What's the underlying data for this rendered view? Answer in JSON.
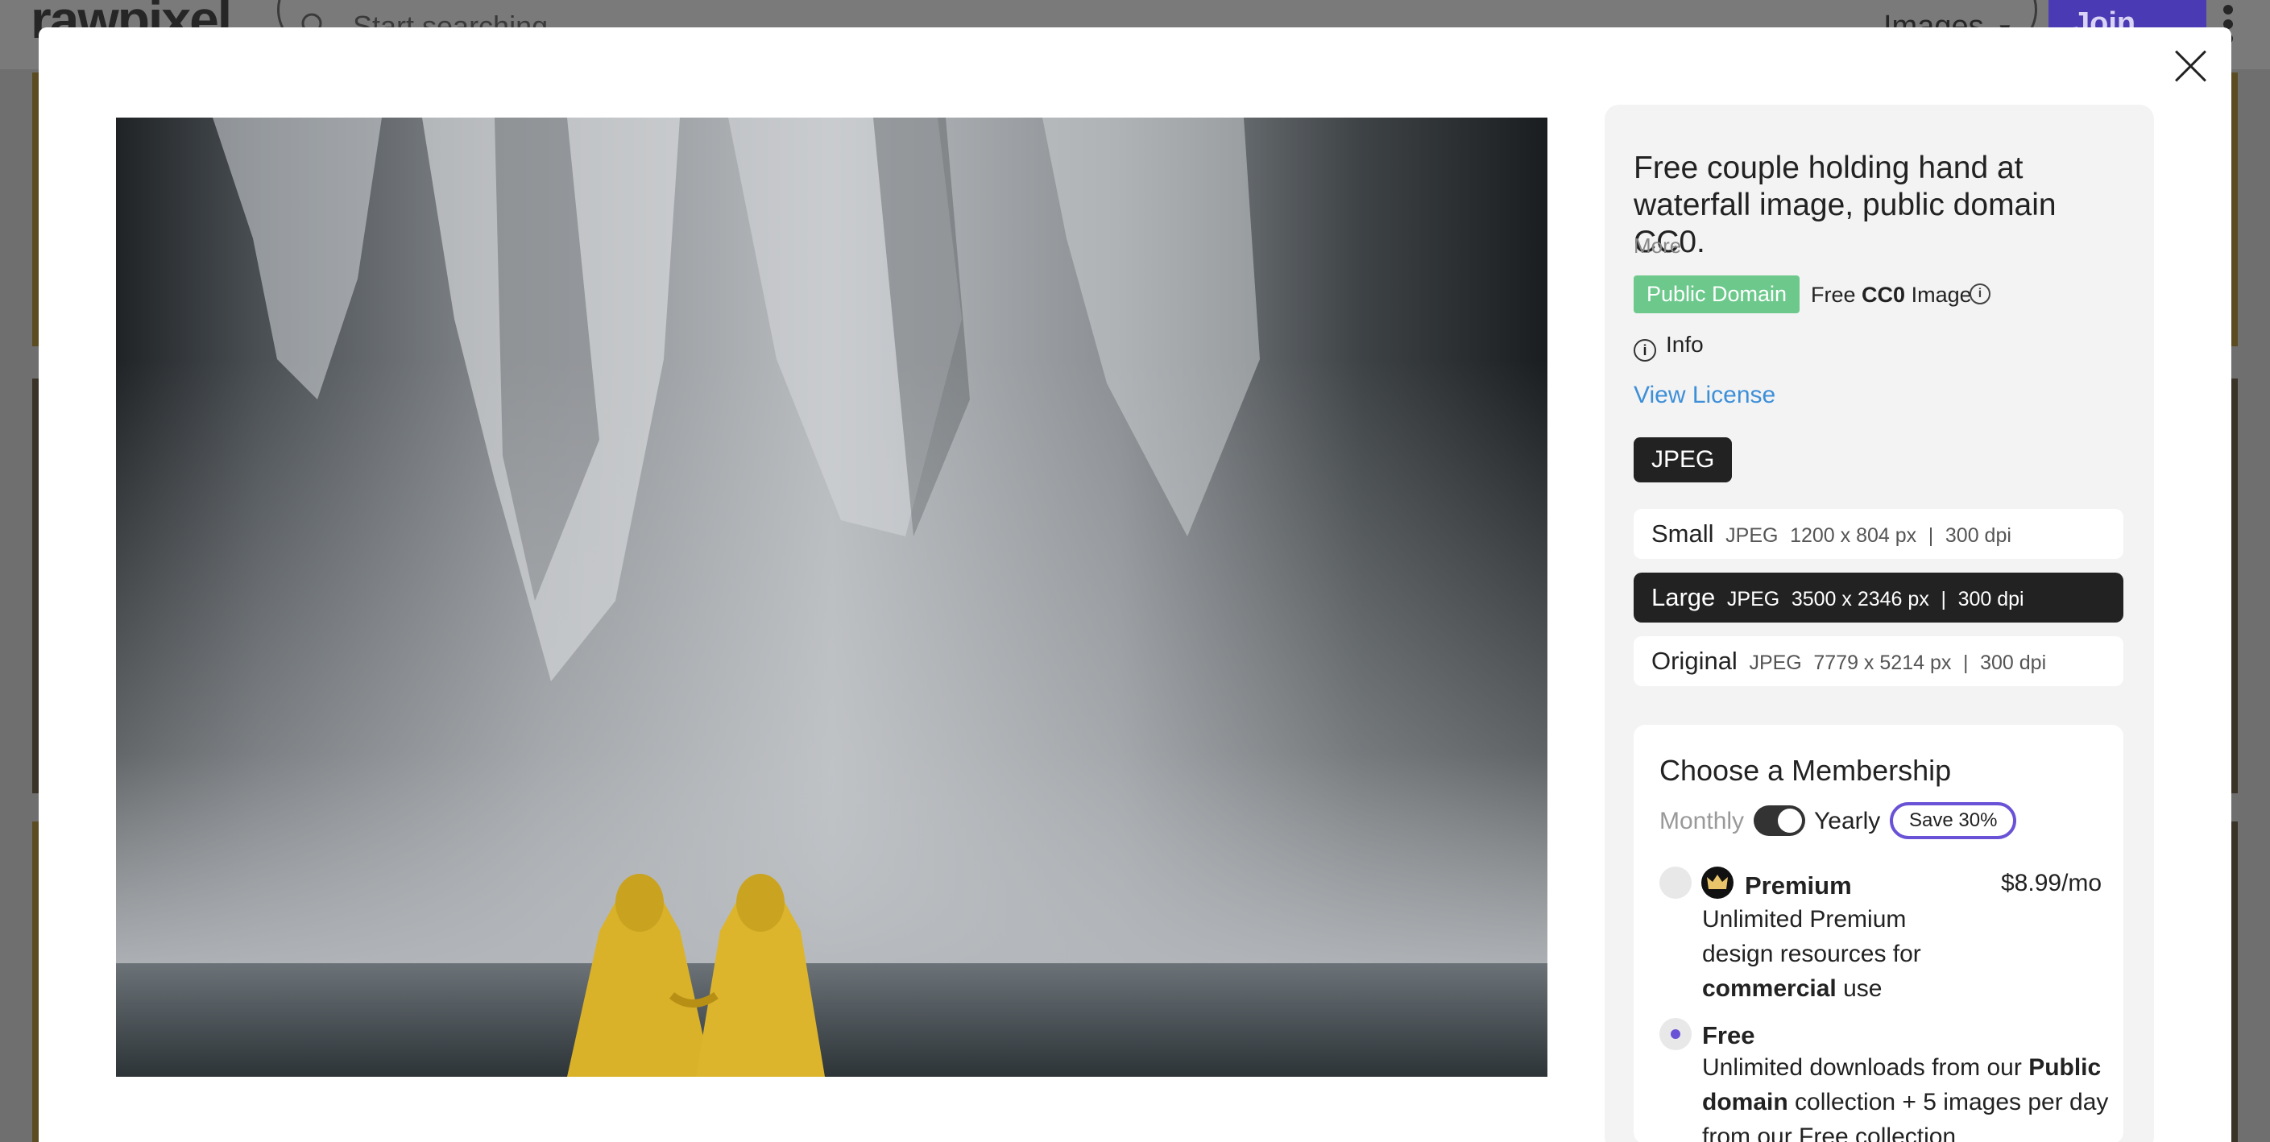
{
  "header": {
    "logo_text": "rawpixel",
    "search_placeholder": "Start searching",
    "category_label": "Images",
    "join_label": "Join Free"
  },
  "modal": {
    "title": "Free couple holding hand at waterfall image, public domain CC0.",
    "more_label": "More",
    "license_badge": "Public Domain",
    "license_free": "Free",
    "license_cc0": "CC0",
    "license_image": "Image",
    "info_label": "Info",
    "view_license_label": "View License",
    "format_label": "JPEG",
    "sizes": [
      {
        "name": "Small",
        "format": "JPEG",
        "dims": "1200 x 804 px",
        "dpi": "300 dpi"
      },
      {
        "name": "Large",
        "format": "JPEG",
        "dims": "3500 x 2346 px",
        "dpi": "300 dpi"
      },
      {
        "name": "Original",
        "format": "JPEG",
        "dims": "7779 x 5214 px",
        "dpi": "300 dpi"
      }
    ],
    "selected_size": "Large",
    "membership": {
      "title": "Choose a Membership",
      "monthly_label": "Monthly",
      "yearly_label": "Yearly",
      "save_label": "Save 30%",
      "premium": {
        "name": "Premium",
        "price": "$8.99/mo",
        "desc_1": "Unlimited Premium",
        "desc_2": "design resources for",
        "desc_bold": "commercial",
        "desc_3": "use"
      },
      "free": {
        "name": "Free",
        "desc_1": "Unlimited downloads from our",
        "desc_bold_1": "Public",
        "desc_bold_2": "domain",
        "desc_2": "collection + 5 images per day",
        "desc_3": "from our Free collection"
      },
      "selected_plan": "Free"
    }
  },
  "colors": {
    "accent": "#6a52d6",
    "link": "#3d8fd8",
    "public_domain": "#6cc98b",
    "dark": "#222222"
  }
}
